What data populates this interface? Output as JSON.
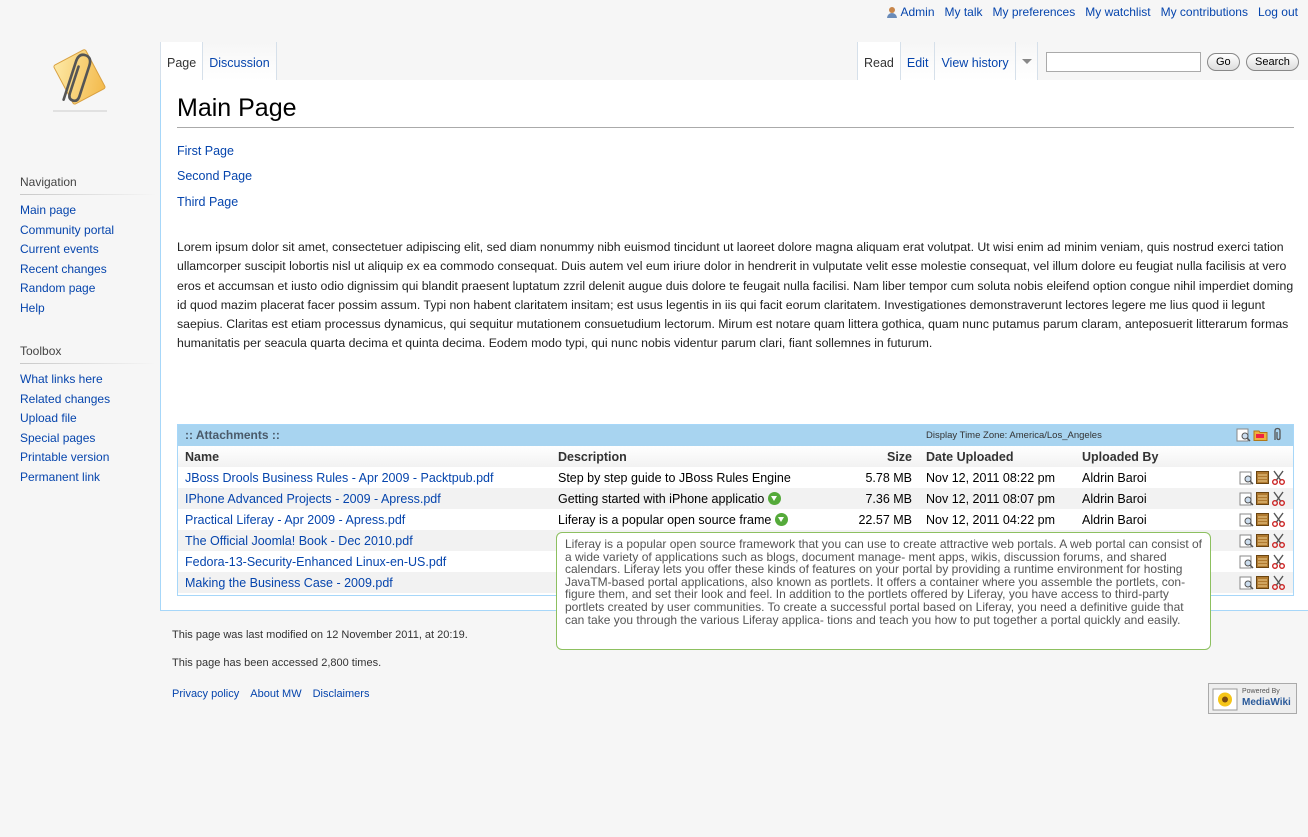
{
  "personal_tools": [
    {
      "label": "Admin"
    },
    {
      "label": "My talk"
    },
    {
      "label": "My preferences"
    },
    {
      "label": "My watchlist"
    },
    {
      "label": "My contributions"
    },
    {
      "label": "Log out"
    }
  ],
  "tabs_left": [
    {
      "label": "Page",
      "selected": true
    },
    {
      "label": "Discussion",
      "selected": false
    }
  ],
  "tabs_right": [
    {
      "label": "Read",
      "selected": true
    },
    {
      "label": "Edit",
      "selected": false
    },
    {
      "label": "View history",
      "selected": false
    }
  ],
  "search": {
    "value": "",
    "go_label": "Go",
    "search_label": "Search"
  },
  "navigation": {
    "heading": "Navigation",
    "items": [
      "Main page",
      "Community portal",
      "Current events",
      "Recent changes",
      "Random page",
      "Help"
    ]
  },
  "toolbox": {
    "heading": "Toolbox",
    "items": [
      "What links here",
      "Related changes",
      "Upload file",
      "Special pages",
      "Printable version",
      "Permanent link"
    ]
  },
  "page": {
    "title": "Main Page",
    "links": [
      "First Page",
      "Second Page",
      "Third Page"
    ],
    "body": "Lorem ipsum dolor sit amet, consectetuer adipiscing elit, sed diam nonummy nibh euismod tincidunt ut laoreet dolore magna aliquam erat volutpat. Ut wisi enim ad minim veniam, quis nostrud exerci tation ullamcorper suscipit lobortis nisl ut aliquip ex ea commodo consequat. Duis autem vel eum iriure dolor in hendrerit in vulputate velit esse molestie consequat, vel illum dolore eu feugiat nulla facilisis at vero eros et accumsan et iusto odio dignissim qui blandit praesent luptatum zzril delenit augue duis dolore te feugait nulla facilisi. Nam liber tempor cum soluta nobis eleifend option congue nihil imperdiet doming id quod mazim placerat facer possim assum. Typi non habent claritatem insitam; est usus legentis in iis qui facit eorum claritatem. Investigationes demonstraverunt lectores legere me lius quod ii legunt saepius. Claritas est etiam processus dynamicus, qui sequitur mutationem consuetudium lectorum. Mirum est notare quam littera gothica, quam nunc putamus parum claram, anteposuerit litterarum formas humanitatis per seacula quarta decima et quinta decima. Eodem modo typi, qui nunc nobis videntur parum clari, fiant sollemnes in futurum."
  },
  "attachments": {
    "title": ":: Attachments ::",
    "timezone": "Display Time Zone: America/Los_Angeles",
    "columns": {
      "name": "Name",
      "description": "Description",
      "size": "Size",
      "date": "Date Uploaded",
      "by": "Uploaded By"
    },
    "rows": [
      {
        "name": "JBoss Drools Business Rules - Apr 2009 - Packtpub.pdf",
        "description": "Step by step guide to JBoss Rules Engine",
        "size": "5.78 MB",
        "date": "Nov 12, 2011 08:22 pm",
        "by": "Aldrin Baroi"
      },
      {
        "name": "IPhone Advanced Projects - 2009 - Apress.pdf",
        "description": "Getting started with iPhone applicatio",
        "size": "7.36 MB",
        "date": "Nov 12, 2011 08:07 pm",
        "by": "Aldrin Baroi"
      },
      {
        "name": "Practical Liferay - Apr 2009 - Apress.pdf",
        "description": "Liferay is a popular open source frame",
        "size": "22.57 MB",
        "date": "Nov 12, 2011 04:22 pm",
        "by": "Aldrin Baroi"
      },
      {
        "name": "The Official Joomla! Book - Dec 2010.pdf",
        "description": "",
        "size": "",
        "date": "",
        "by": ""
      },
      {
        "name": "Fedora-13-Security-Enhanced Linux-en-US.pdf",
        "description": "",
        "size": "",
        "date": "",
        "by": ""
      },
      {
        "name": "Making the Business Case - 2009.pdf",
        "description": "",
        "size": "",
        "date": "",
        "by": ""
      }
    ]
  },
  "tooltip": "Liferay is a popular open source framework that you can use to create attractive web portals. A web portal can consist of a wide variety of applications such as blogs, document manage- ment apps, wikis, discussion forums, and shared calendars. Liferay lets you offer these kinds of features on your portal by providing a runtime environment for hosting JavaTM-based portal applications, also known as portlets. It offers a container where you assemble the portlets, con- figure them, and set their look and feel. In addition to the portlets offered by Liferay, you have access to third-party portlets created by user communities. To create a successful portal based on Liferay, you need a definitive guide that can take you through the various Liferay applica- tions and teach you how to put together a portal quickly and easily.",
  "footer": {
    "modified": "This page was last modified on 12 November 2011, at 20:19.",
    "accessed": "This page has been accessed 2,800 times.",
    "links": [
      "Privacy policy",
      "About MW",
      "Disclaimers"
    ],
    "powered_top": "Powered By",
    "powered_bottom": "MediaWiki"
  }
}
